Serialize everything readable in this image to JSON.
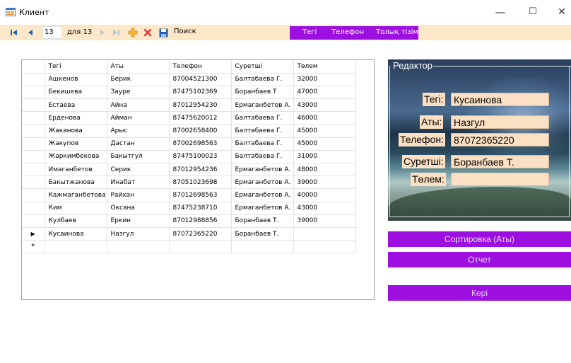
{
  "window": {
    "title": "Клиент",
    "minimize_glyph": "—",
    "maximize_glyph": "☐",
    "close_glyph": "✕"
  },
  "toolbar": {
    "position_value": "13",
    "of_text": "для 13",
    "search_label": "Поиск",
    "tabs": [
      "Тегі",
      "Телефон",
      "Толық тізім"
    ],
    "accent_color": "#9c0fe0"
  },
  "grid": {
    "columns": [
      "Тегі",
      "Аты",
      "Телефон",
      "Суретші",
      "Төлем"
    ],
    "rows": [
      [
        "Ашкенов",
        "Берик",
        "87004521300",
        "Балтабаева Г.",
        "32000"
      ],
      [
        "Бекишева",
        "Зауре",
        "87475102369",
        "Боранбаев Т",
        "47000"
      ],
      [
        "Естаева",
        "Айна",
        "87012954230",
        "Ермаганбетов А.",
        "43000"
      ],
      [
        "Ерденова",
        "Айман",
        "87475620012",
        "Балтабаева Г.",
        "46000"
      ],
      [
        "Жаканова",
        "Арыс",
        "87002658400",
        "Балтабаева Г.",
        "45000"
      ],
      [
        "Жакупов",
        "Дастан",
        "87002698563",
        "Балтабаева Г.",
        "45000"
      ],
      [
        "Жаркимбекова",
        "Бакытгул",
        "87475100023",
        "Балтабаева Г.",
        "31000"
      ],
      [
        "Имаганбетов",
        "Серик",
        "87012954236",
        "Ермаганбетов А.",
        "48000"
      ],
      [
        "Бакытжанова",
        "Инабат",
        "87051023698",
        "Ермаганбетов А.",
        "39000"
      ],
      [
        "Кажмаганбетова",
        "Райхан",
        "87012698563",
        "Ермаганбетов А.",
        "40000"
      ],
      [
        "Ким",
        "Оксана",
        "87475238710",
        "Ермаганбетов А.",
        "43000"
      ],
      [
        "Кулбаев",
        "Еркин",
        "87012988856",
        "Боранбаев Т.",
        "39000"
      ],
      [
        "Кусаинова",
        "Назгул",
        "87072365220",
        "Боранбаев Т.",
        ""
      ],
      [
        "",
        "",
        "",
        "",
        ""
      ]
    ],
    "current_row_marker": "▶",
    "new_row_marker": "*"
  },
  "editor": {
    "legend": "Редактор",
    "fields": [
      {
        "label": "Тегі:",
        "value": "Кусаинова"
      },
      {
        "label": "Аты:",
        "value": "Назгул"
      },
      {
        "label": "Телефон:",
        "value": "87072365220"
      },
      {
        "label": "Суретші:",
        "value": "Боранбаев Т."
      },
      {
        "label": "Төлем:",
        "value": ""
      }
    ]
  },
  "actions": {
    "sort_label": "Сортировка (Аты)",
    "report_label": "Отчет",
    "back_label": "Кері"
  },
  "icons": [
    "move-first-icon",
    "move-previous-icon",
    "move-next-icon",
    "move-last-icon",
    "add-icon",
    "delete-icon",
    "save-icon",
    "app-form-icon"
  ]
}
